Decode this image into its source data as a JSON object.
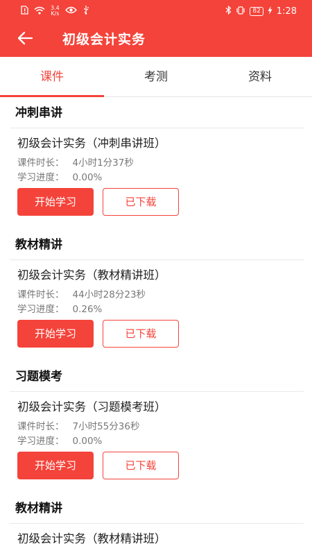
{
  "status_bar": {
    "net_speed_value": "3.4",
    "net_speed_unit": "K/s",
    "battery": "82",
    "time": "1:28"
  },
  "app_bar": {
    "title": "初级会计实务",
    "back_icon": "arrow-left-icon"
  },
  "tabs": [
    {
      "label": "课件",
      "active": true
    },
    {
      "label": "考测",
      "active": false
    },
    {
      "label": "资料",
      "active": false
    }
  ],
  "labels": {
    "duration": "课件时长：",
    "progress": "学习进度：",
    "start_button": "开始学习",
    "downloaded_button": "已下载"
  },
  "sections": [
    {
      "title": "冲刺串讲",
      "course": "初级会计实务（冲刺串讲班）",
      "duration": "4小时1分37秒",
      "progress": "0.00%"
    },
    {
      "title": "教材精讲",
      "course": "初级会计实务（教材精讲班）",
      "duration": "44小时28分23秒",
      "progress": "0.26%"
    },
    {
      "title": "习题模考",
      "course": "初级会计实务（习题模考班）",
      "duration": "7小时55分36秒",
      "progress": "0.00%"
    },
    {
      "title": "教材精讲",
      "course": "初级会计实务（教材精讲班）",
      "duration": "",
      "progress": ""
    }
  ],
  "colors": {
    "accent": "#f4433a"
  }
}
